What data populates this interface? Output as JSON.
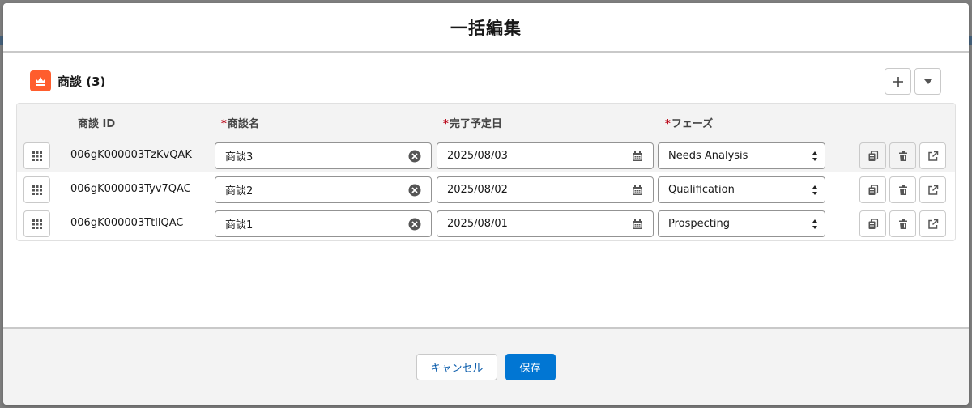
{
  "modal": {
    "title": "一括編集"
  },
  "card": {
    "title": "商談 (3)",
    "icon": "crown-icon"
  },
  "header_actions": [
    {
      "name": "add-row-button",
      "icon": "plus-icon"
    },
    {
      "name": "more-actions-button",
      "icon": "chevron-down-icon"
    }
  ],
  "table": {
    "columns": {
      "id": "商談 ID",
      "name": "商談名",
      "close_date": "完了予定日",
      "stage": "フェーズ"
    },
    "required_marker": "*",
    "rows": [
      {
        "id": "006gK000003TzKvQAK",
        "name": "商談3",
        "close_date": "2025/08/03",
        "stage": "Needs Analysis"
      },
      {
        "id": "006gK000003Tyv7QAC",
        "name": "商談2",
        "close_date": "2025/08/02",
        "stage": "Qualification"
      },
      {
        "id": "006gK000003TtllQAC",
        "name": "商談1",
        "close_date": "2025/08/01",
        "stage": "Prospecting"
      }
    ]
  },
  "footer": {
    "cancel_label": "キャンセル",
    "save_label": "保存"
  },
  "colors": {
    "brand": "#0176d3",
    "object_icon": "#ff5d2d",
    "required": "#ba0517"
  }
}
